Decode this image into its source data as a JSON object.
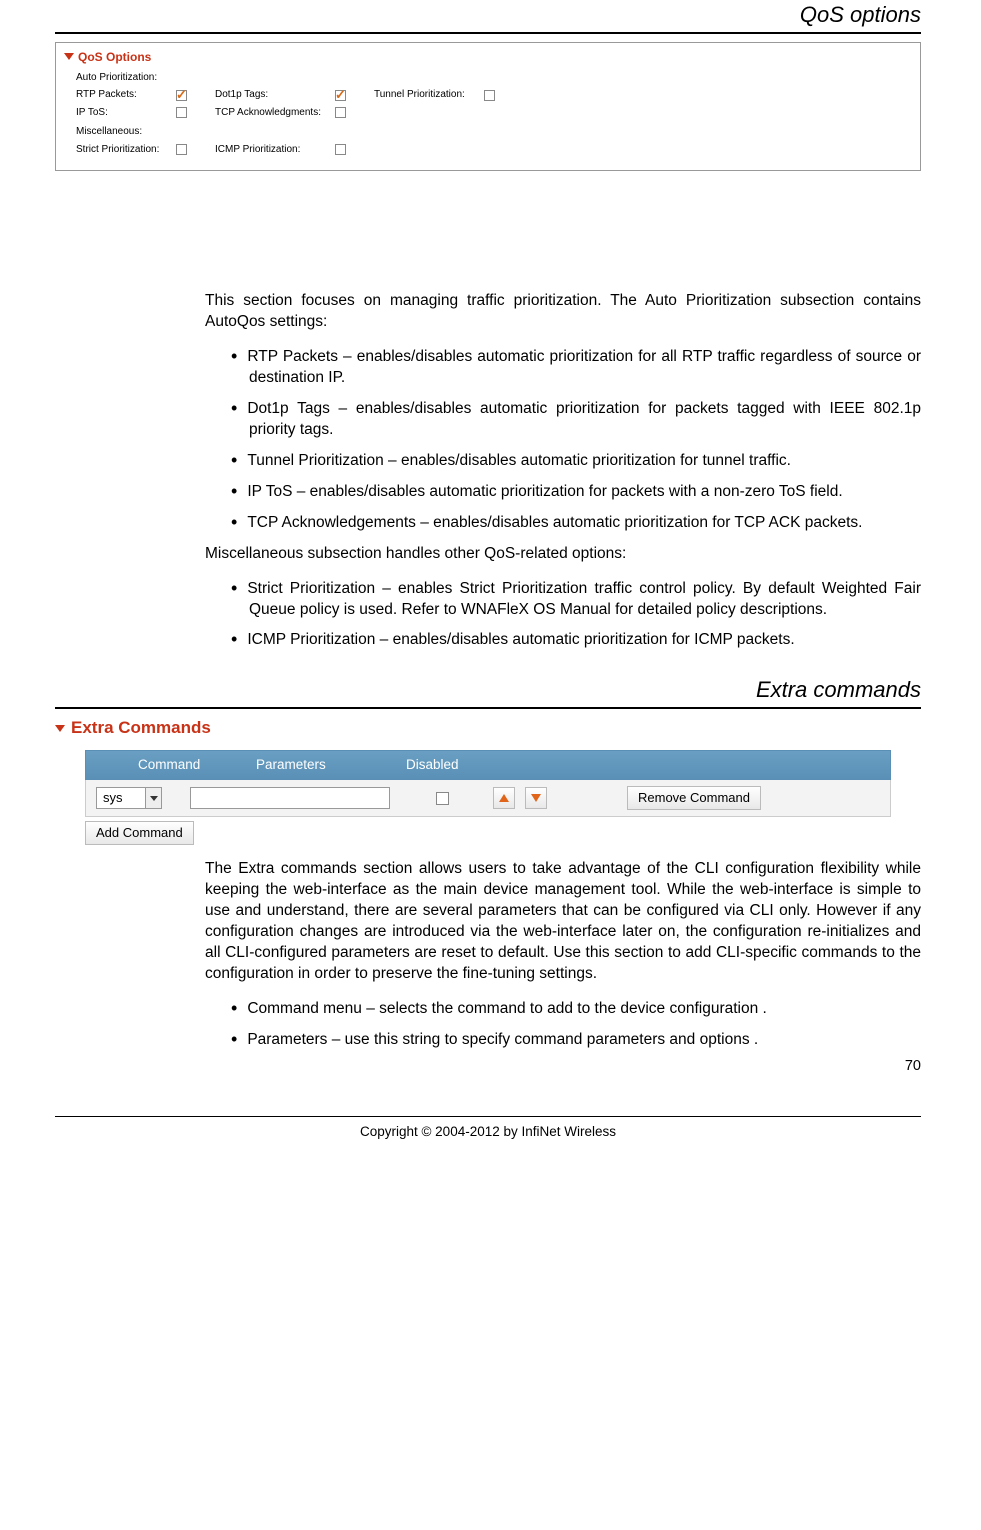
{
  "headers": {
    "qos": "QoS options",
    "extra": "Extra commands"
  },
  "shot1": {
    "title": "QoS Options",
    "auto_label": "Auto Prioritization:",
    "misc_label": "Miscellaneous:",
    "fields": {
      "rtp": "RTP Packets:",
      "dot1p": "Dot1p Tags:",
      "tunnel": "Tunnel Prioritization:",
      "iptos": "IP ToS:",
      "tcpack": "TCP Acknowledgments:",
      "strict": "Strict Prioritization:",
      "icmp": "ICMP Prioritization:"
    }
  },
  "qos_intro": "This section focuses on managing traffic prioritization. The Auto Prioritization subsection contains AutoQos settings:",
  "qos_items": [
    "RTP Packets – enables/disables automatic prioritization for all RTP traffic regardless of source or destination IP.",
    "Dot1p Tags – enables/disables automatic prioritization for packets tagged with IEEE 802.1p priority tags.",
    "Tunnel Prioritization – enables/disables automatic prioritization for tunnel traffic.",
    "IP ToS – enables/disables automatic prioritization for packets with a non-zero ToS field.",
    "TCP Acknowledgements –  enables/disables automatic prioritization for TCP ACK packets."
  ],
  "misc_intro": "Miscellaneous subsection handles other QoS-related options:",
  "misc_items": [
    "Strict Prioritization – enables Strict Prioritization traffic control policy. By default Weighted Fair Queue policy is used. Refer to WNAFleX OS Manual for detailed policy descriptions.",
    "ICMP Prioritization – enables/disables automatic prioritization for ICMP packets."
  ],
  "shot2": {
    "title": "Extra Commands",
    "headers": {
      "c1": "Command",
      "c2": "Parameters",
      "c3": "Disabled"
    },
    "select_value": "sys",
    "remove_btn": "Remove Command",
    "add_btn": "Add Command"
  },
  "extra_para": "The Extra commands section allows users to take advantage of the CLI configuration flexibility while keeping the web-interface as the main device management tool. While the web-interface is simple to use and understand, there are several parameters that can be configured via CLI only. However if any configuration changes are introduced via the web-interface later on, the configuration re-initializes and all CLI-configured parameters are reset to default. Use this section to add CLI-specific commands to the configuration in order to preserve the fine-tuning settings.",
  "extra_items": [
    "Command menu – selects the command to add to the device configuration .",
    "Parameters – use this string to specify command parameters and options ."
  ],
  "page_number": "70",
  "copyright": "Copyright © 2004-2012 by InfiNet Wireless"
}
